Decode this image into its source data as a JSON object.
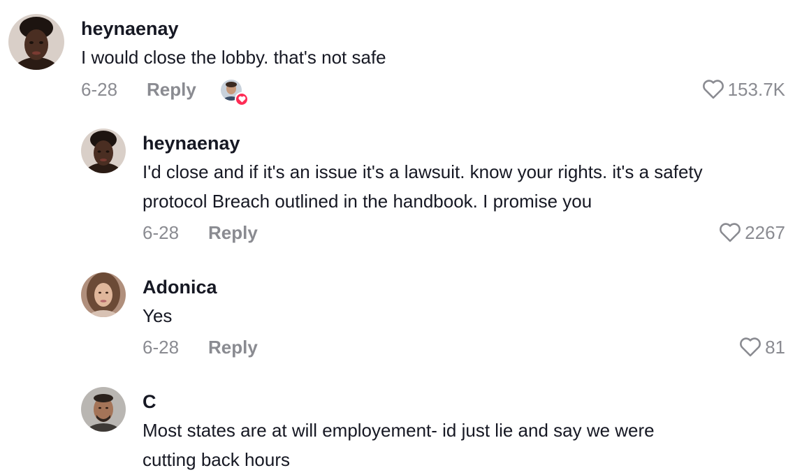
{
  "comments": [
    {
      "username": "heynaenay",
      "lines": [
        "I would close the lobby. that's not safe"
      ],
      "date": "6-28",
      "reply_label": "Reply",
      "likes": "153.7K",
      "avatar_icon": "profile-photo",
      "creator_liked": true
    },
    {
      "username": "heynaenay",
      "lines": [
        "I'd close and if it's an issue it's a lawsuit. know your rights. it's a safety",
        "protocol Breach outlined in the handbook. I promise you"
      ],
      "date": "6-28",
      "reply_label": "Reply",
      "likes": "2267",
      "avatar_icon": "profile-photo"
    },
    {
      "username": "Adonica",
      "lines": [
        "Yes"
      ],
      "date": "6-28",
      "reply_label": "Reply",
      "likes": "81",
      "avatar_icon": "profile-photo"
    },
    {
      "username": "C",
      "lines": [
        "Most states are at will employement- id just lie and say we were",
        "cutting back hours"
      ],
      "avatar_icon": "profile-photo"
    }
  ],
  "colors": {
    "text": "#161823",
    "muted": "#8a8b91",
    "heart_badge": "#fe2c55"
  },
  "icons": {
    "like": "heart-outline-icon",
    "creator_like": "heart-badge-icon"
  }
}
